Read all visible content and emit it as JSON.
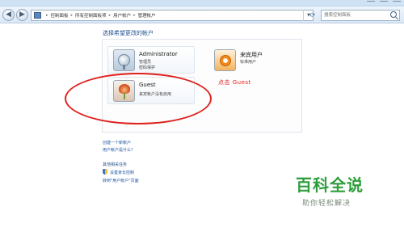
{
  "address_bar": {
    "breadcrumbs": [
      "控制面板",
      "所有控制面板项",
      "用户帐户",
      "管理帐户"
    ],
    "search_placeholder": "搜索控制面板"
  },
  "page": {
    "title": "选择希望更改的帐户"
  },
  "accounts": [
    {
      "name": "Administrator",
      "role": "管理员",
      "detail": "密码保护"
    },
    {
      "name": "来宾用户",
      "role": "标准用户"
    },
    {
      "name": "Guest",
      "role": "来宾帐户没有启用"
    }
  ],
  "links": {
    "create_account": "创建一个新帐户",
    "what_is_account": "用户帐户是什么？",
    "section_title": "其他相关任务",
    "parental_controls": "设置家长控制",
    "goto_main": "转到\"用户帐户\"页面"
  },
  "annotation": {
    "text": "点击 Guest",
    "color": "#e0201c"
  },
  "watermark": {
    "title": "百科全说",
    "subtitle": "助你轻松解决"
  },
  "colors": {
    "link": "#1f57a3",
    "watermark": "#2e9e3c"
  }
}
